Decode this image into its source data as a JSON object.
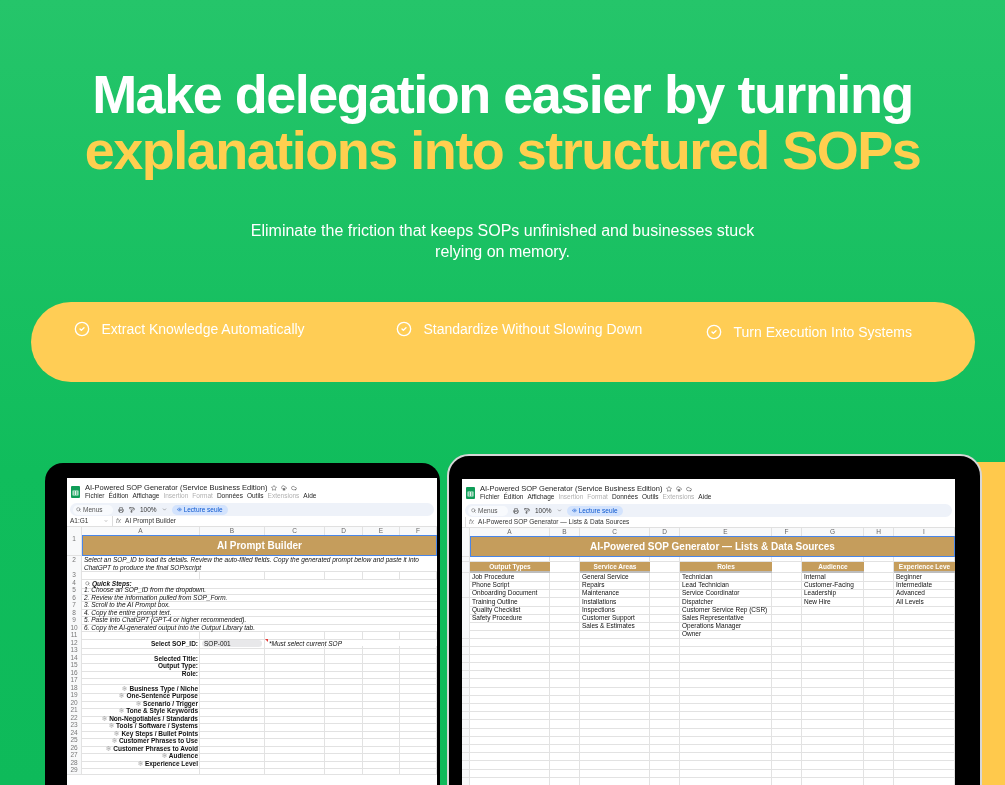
{
  "headline": {
    "line1": "Make delegation easier by turning",
    "line2": "explanations into structured SOPs"
  },
  "subtitle": "Eliminate the friction that keeps SOPs unfinished and businesses stuck relying on memory.",
  "features": [
    "Extract Knowledge Automatically",
    "Standardize Without Slowing Down",
    "Turn Execution Into Systems"
  ],
  "sheets": [
    {
      "kind": "form",
      "doc_title": "AI-Powered SOP Generator (Service Business Edition)",
      "menu": [
        {
          "label": "Fichier",
          "disabled": false
        },
        {
          "label": "Édition",
          "disabled": false
        },
        {
          "label": "Affichage",
          "disabled": false
        },
        {
          "label": "Insertion",
          "disabled": true
        },
        {
          "label": "Format",
          "disabled": true
        },
        {
          "label": "Données",
          "disabled": false
        },
        {
          "label": "Outils",
          "disabled": false
        },
        {
          "label": "Extensions",
          "disabled": true
        },
        {
          "label": "Aide",
          "disabled": false
        }
      ],
      "search": {
        "placeholder": "Menus"
      },
      "zoom": "100%",
      "mode": "Lecture seule",
      "name_box": "A1:G1",
      "fx": "fx",
      "formula": "AI Prompt Builder",
      "columns": [
        "A",
        "B",
        "C",
        "D",
        "E",
        "F"
      ],
      "rows": [
        {
          "number": "1",
          "kind": "banner",
          "text": "AI Prompt Builder"
        },
        {
          "number": "2",
          "kind": "note",
          "text": "Select an SOP_ID to load its details. Review the auto-filled fields. Copy the generated prompt below and paste it into ChatGPT to produce the final SOP/script"
        },
        {
          "number": "3",
          "kind": "blank"
        },
        {
          "number": "4",
          "kind": "heading",
          "text": "Quick Steps:"
        },
        {
          "number": "5",
          "kind": "step",
          "text": "1. Choose an SOP_ID from the dropdown."
        },
        {
          "number": "6",
          "kind": "step",
          "text": "2. Review the information pulled from SOP_Form."
        },
        {
          "number": "7",
          "kind": "step",
          "text": "3. Scroll to the AI Prompt box."
        },
        {
          "number": "8",
          "kind": "step",
          "text": "4. Copy the entire prompt text."
        },
        {
          "number": "9",
          "kind": "step",
          "text": "5. Paste into ChatGPT (GPT-4 or higher recommended)."
        },
        {
          "number": "10",
          "kind": "step",
          "text": "6. Copy the AI-generated output into the Output Library tab."
        },
        {
          "number": "11",
          "kind": "blank"
        },
        {
          "number": "12",
          "kind": "select",
          "text": "Select SOP_ID:",
          "value": "SOP-001",
          "note": "*Must select current SOP"
        },
        {
          "number": "13",
          "kind": "blank"
        },
        {
          "number": "14",
          "kind": "label",
          "text": "Selected Title:"
        },
        {
          "number": "15",
          "kind": "label",
          "text": "Output Type:"
        },
        {
          "number": "16",
          "kind": "label",
          "text": "Role:"
        },
        {
          "number": "17",
          "kind": "blank"
        },
        {
          "number": "18",
          "kind": "bullet_label",
          "text": "Business Type / Niche"
        },
        {
          "number": "19",
          "kind": "bullet_label",
          "text": "One-Sentence Purpose"
        },
        {
          "number": "20",
          "kind": "bullet_label",
          "text": "Scenario / Trigger"
        },
        {
          "number": "21",
          "kind": "bullet_label",
          "text": "Tone & Style Keywords"
        },
        {
          "number": "22",
          "kind": "bullet_label",
          "text": "Non-Negotiables / Standards"
        },
        {
          "number": "23",
          "kind": "bullet_label",
          "text": "Tools / Software / Systems"
        },
        {
          "number": "24",
          "kind": "bullet_label",
          "text": "Key Steps / Bullet Points"
        },
        {
          "number": "25",
          "kind": "bullet_label",
          "text": "Customer Phrases to Use"
        },
        {
          "number": "26",
          "kind": "bullet_label",
          "text": "Customer Phrases to Avoid"
        },
        {
          "number": "27",
          "kind": "bullet_label",
          "text": "Audience"
        },
        {
          "number": "28",
          "kind": "bullet_label",
          "text": "Experience Level"
        },
        {
          "number": "29",
          "kind": "blank"
        }
      ]
    },
    {
      "kind": "lists",
      "doc_title": "AI-Powered SOP Generator (Service Business Edition)",
      "menu": [
        {
          "label": "Fichier",
          "disabled": false
        },
        {
          "label": "Édition",
          "disabled": false
        },
        {
          "label": "Affichage",
          "disabled": false
        },
        {
          "label": "Insertion",
          "disabled": true
        },
        {
          "label": "Format",
          "disabled": true
        },
        {
          "label": "Données",
          "disabled": false
        },
        {
          "label": "Outils",
          "disabled": false
        },
        {
          "label": "Extensions",
          "disabled": true
        },
        {
          "label": "Aide",
          "disabled": false
        }
      ],
      "search": {
        "placeholder": "Menus"
      },
      "zoom": "100%",
      "mode": "Lecture seule",
      "fx": "fx",
      "formula": "AI-Powered SOP Generator — Lists & Data Sources",
      "columns": [
        "A",
        "B",
        "C",
        "D",
        "E",
        "F",
        "G",
        "H",
        "I"
      ],
      "banner": "AI-Powered SOP Generator — Lists & Data Sources",
      "lists": [
        {
          "heading": "Output Types",
          "items": [
            "Job Procedure",
            "Phone Script",
            "Onboarding Document",
            "Training Outline",
            "Quality Checklist",
            "Safety Procedure"
          ]
        },
        {
          "heading": "Service Areas",
          "items": [
            "General Service",
            "Repairs",
            "Maintenance",
            "Installations",
            "Inspections",
            "Customer Support",
            "Sales & Estimates"
          ]
        },
        {
          "heading": "Roles",
          "items": [
            "Technician",
            "Lead Technician",
            "Service Coordinator",
            "Dispatcher",
            "Customer Service Rep (CSR)",
            "Sales Representative",
            "Operations Manager",
            "Owner"
          ]
        },
        {
          "heading": "Audience",
          "items": [
            "Internal",
            "Customer-Facing",
            "Leadership",
            "New Hire"
          ]
        },
        {
          "heading": "Experience Leve",
          "items": [
            "Beginner",
            "Intermediate",
            "Advanced",
            "All Levels"
          ]
        }
      ]
    }
  ]
}
